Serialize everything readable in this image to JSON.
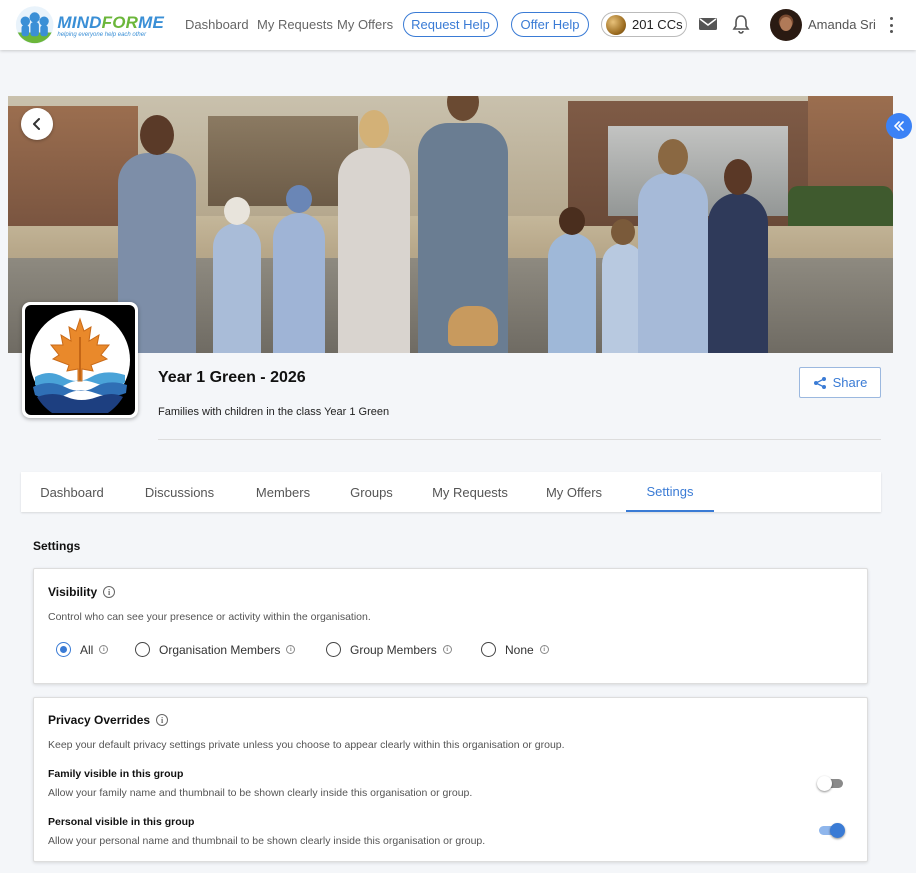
{
  "nav": {
    "logo": {
      "title_mind": "MIND",
      "title_for": "FOR",
      "title_me": "ME",
      "tagline": "helping everyone help each other"
    },
    "links": [
      "Dashboard",
      "My Requests",
      "My Offers"
    ],
    "request_help": "Request Help",
    "offer_help": "Offer Help",
    "credits": "201 CCs",
    "user_name": "Amanda Sri"
  },
  "group": {
    "title": "Year 1 Green - 2026",
    "description": "Families with children in the class Year 1 Green",
    "share_label": "Share"
  },
  "tabs": [
    {
      "label": "Dashboard",
      "active": false
    },
    {
      "label": "Discussions",
      "active": false
    },
    {
      "label": "Members",
      "active": false
    },
    {
      "label": "Groups",
      "active": false
    },
    {
      "label": "My Requests",
      "active": false
    },
    {
      "label": "My Offers",
      "active": false
    },
    {
      "label": "Settings",
      "active": true
    }
  ],
  "settings": {
    "heading": "Settings",
    "visibility": {
      "title": "Visibility",
      "description": "Control who can see your presence or activity within the organisation.",
      "options": [
        {
          "label": "All",
          "selected": true
        },
        {
          "label": "Organisation Members",
          "selected": false
        },
        {
          "label": "Group Members",
          "selected": false
        },
        {
          "label": "None",
          "selected": false
        }
      ]
    },
    "privacy": {
      "title": "Privacy Overrides",
      "description": "Keep your default privacy settings private unless you choose to appear clearly within this organisation or group.",
      "family": {
        "title": "Family visible in this group",
        "description": "Allow your family name and thumbnail to be shown clearly inside this organisation or group.",
        "enabled": false
      },
      "personal": {
        "title": "Personal visible in this group",
        "description": "Allow your personal name and thumbnail to be shown clearly inside this organisation or group.",
        "enabled": true
      }
    }
  },
  "colors": {
    "accent": "#3a7bd5",
    "brand_green": "#6bb63a"
  }
}
